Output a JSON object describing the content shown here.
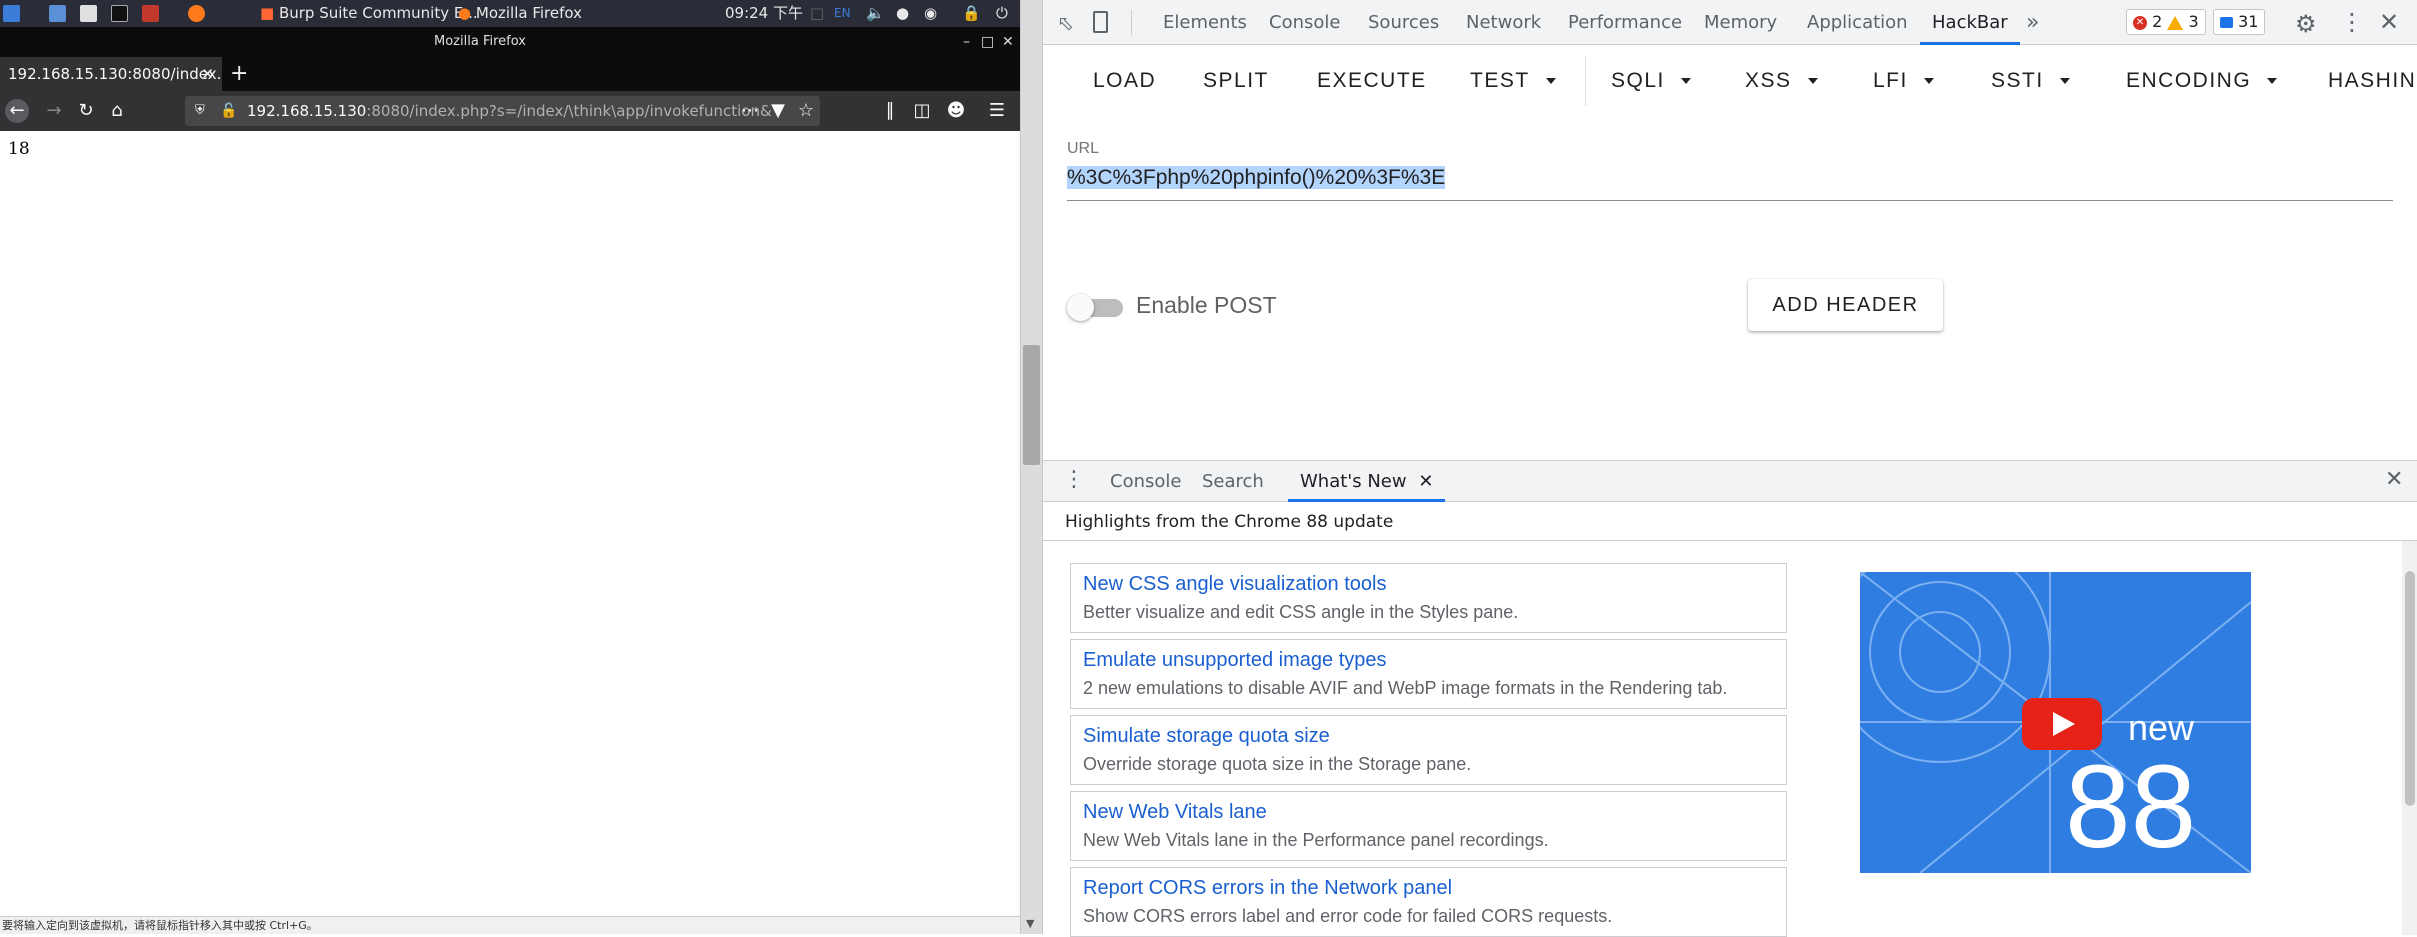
{
  "vm": {
    "taskbar": {
      "burp_label": "Burp Suite Community E...",
      "firefox_label": "Mozilla Firefox",
      "clock": "09:24 下午",
      "lang": "EN"
    },
    "status_hint": "要将输入定向到该虚拟机，请将鼠标指针移入其中或按 Ctrl+G。"
  },
  "firefox": {
    "window_title": "Mozilla Firefox",
    "tab_title": "192.168.15.130:8080/index.p",
    "url_host": "192.168.15.130",
    "url_rest": ":8080/index.php?s=/index/\\think\\app/invokefunction&",
    "page_text": "18"
  },
  "devtools": {
    "tabs": [
      "Elements",
      "Console",
      "Sources",
      "Network",
      "Performance",
      "Memory",
      "Application",
      "HackBar"
    ],
    "active_tab": "HackBar",
    "more_tabs": "»",
    "errors": "2",
    "warnings": "3",
    "messages": "31",
    "hackbar": {
      "buttons": [
        "LOAD",
        "SPLIT",
        "EXECUTE",
        "TEST",
        "SQLI",
        "XSS",
        "LFI",
        "SSTI",
        "ENCODING",
        "HASHIN"
      ],
      "url_label": "URL",
      "url_value": "%3C%3Fphp%20phpinfo()%20%3F%3E",
      "post_label": "Enable POST",
      "post_enabled": false,
      "add_header_label": "ADD HEADER"
    },
    "drawer": {
      "tabs": [
        "Console",
        "Search",
        "What's New"
      ],
      "active_tab": "What's New",
      "highlights": "Highlights from the Chrome 88 update",
      "features": [
        {
          "title": "New CSS angle visualization tools",
          "desc": "Better visualize and edit CSS angle in the Styles pane."
        },
        {
          "title": "Emulate unsupported image types",
          "desc": "2 new emulations to disable AVIF and WebP image formats in the Rendering tab."
        },
        {
          "title": "Simulate storage quota size",
          "desc": "Override storage quota size in the Storage pane."
        },
        {
          "title": "New Web Vitals lane",
          "desc": "New Web Vitals lane in the Performance panel recordings."
        },
        {
          "title": "Report CORS errors in the Network panel",
          "desc": "Show CORS errors label and error code for failed CORS requests."
        }
      ],
      "video": {
        "word": "new",
        "number": "88"
      }
    }
  }
}
